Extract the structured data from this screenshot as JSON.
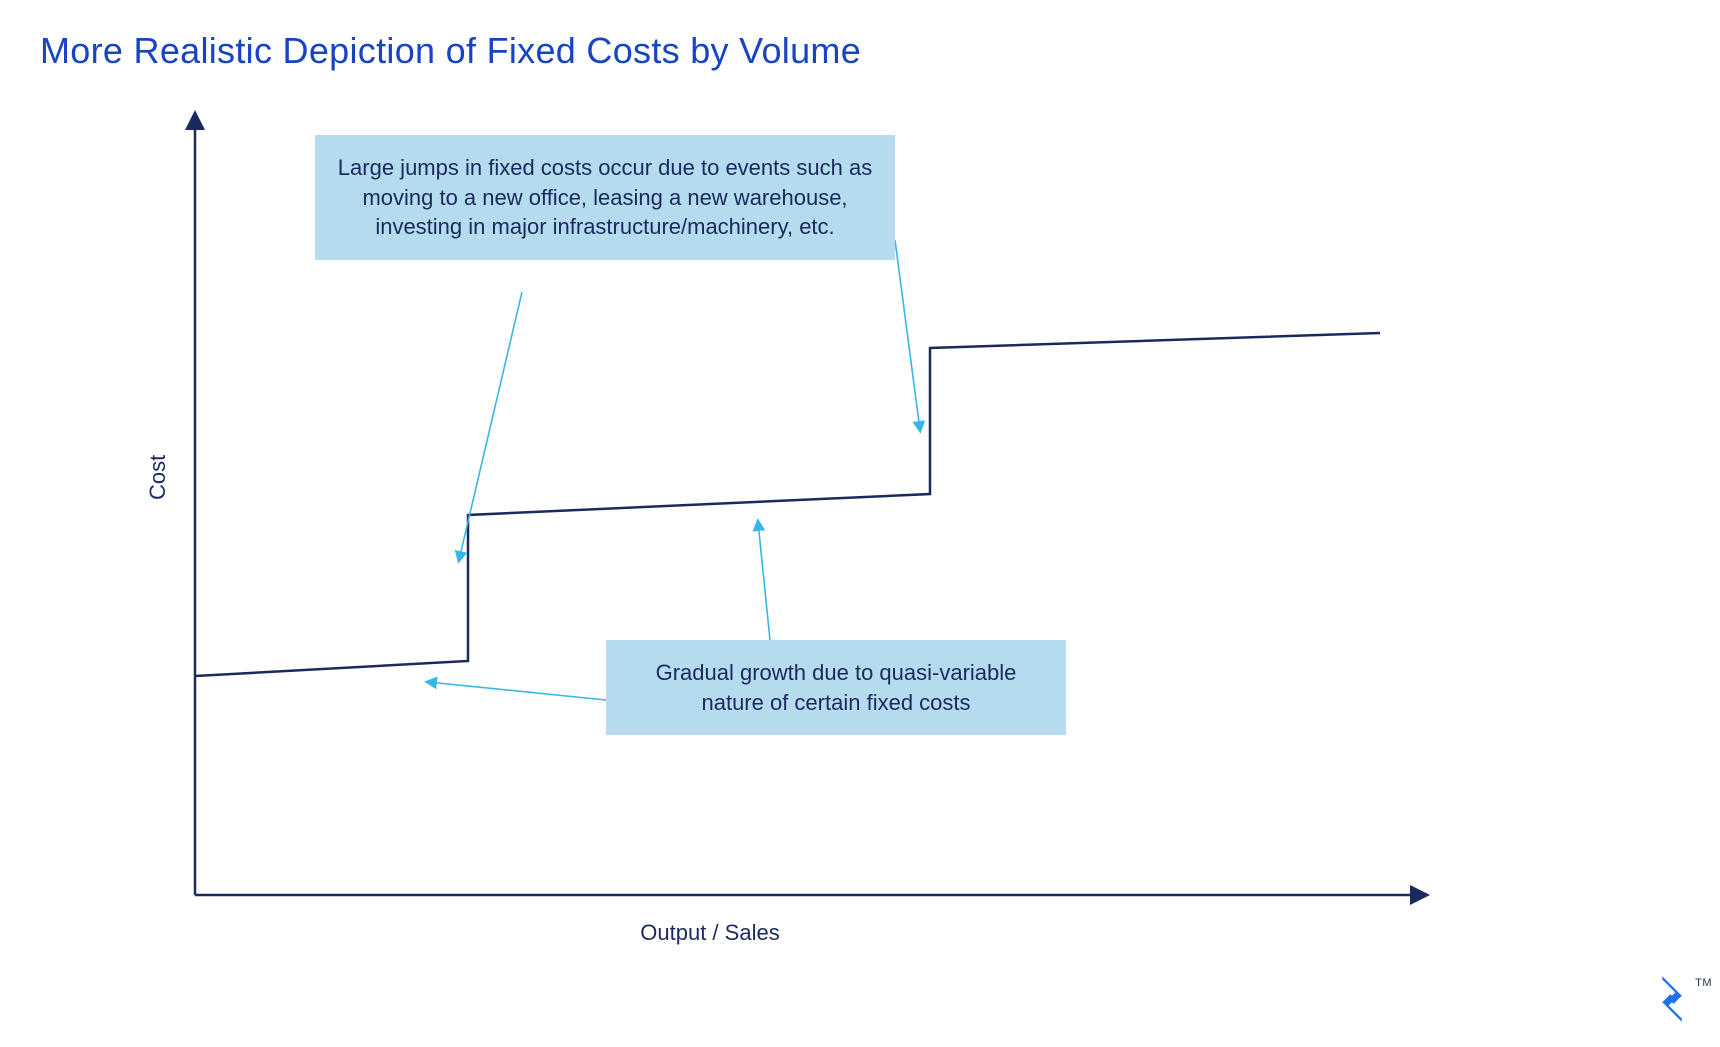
{
  "title": "More Realistic Depiction of Fixed Costs by Volume",
  "xlabel": "Output / Sales",
  "ylabel": "Cost",
  "annotations": {
    "jumps": "Large jumps in fixed costs occur due to events such as moving to a new office, leasing a new warehouse, investing in major infrastructure/machinery, etc.",
    "gradual": "Gradual growth due to quasi-variable nature of certain fixed costs"
  },
  "colors": {
    "title": "#1744c2",
    "axis": "#1a2a5e",
    "line": "#1a2a5e",
    "callout_bg": "#b5dbef",
    "arrow": "#39b6e8",
    "logo": "#1e73e8"
  },
  "chart_data": {
    "type": "line",
    "xlabel": "Output / Sales",
    "ylabel": "Cost",
    "title": "More Realistic Depiction of Fixed Costs by Volume",
    "annotations": [
      "Large jumps in fixed costs occur due to events such as moving to a new office, leasing a new warehouse, investing in major infrastructure/machinery, etc.",
      "Gradual growth due to quasi-variable nature of certain fixed costs"
    ],
    "note": "Qualitative step-function diagram with no numeric axis ticks; values below are approximate relative positions (0–100 scale).",
    "x": [
      0,
      23,
      23,
      62,
      62,
      100
    ],
    "cost": [
      30,
      32,
      52,
      55,
      75,
      77
    ]
  }
}
